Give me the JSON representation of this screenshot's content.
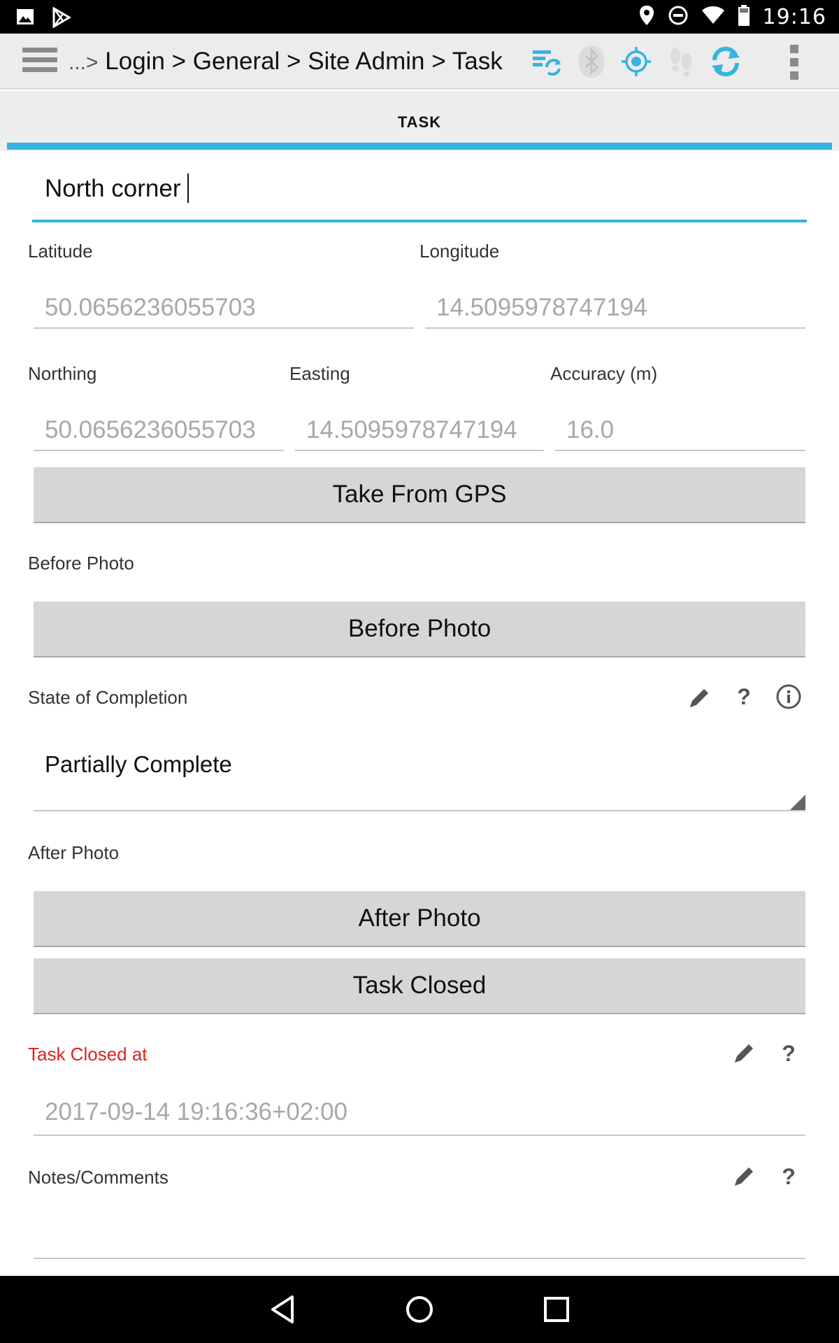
{
  "status_bar": {
    "time": "19:16"
  },
  "toolbar": {
    "breadcrumb_prefix": "...>",
    "breadcrumb": "Login > General > Site Admin > Task",
    "colors": {
      "accent": "#36b3e0"
    }
  },
  "tabs": {
    "active": "TASK"
  },
  "form": {
    "name_value": "North corner",
    "latitude": {
      "label": "Latitude",
      "value": "50.0656236055703"
    },
    "longitude": {
      "label": "Longitude",
      "value": "14.5095978747194"
    },
    "northing": {
      "label": "Northing",
      "value": "50.0656236055703"
    },
    "easting": {
      "label": "Easting",
      "value": "14.5095978747194"
    },
    "accuracy": {
      "label": "Accuracy (m)",
      "value": "16.0"
    },
    "take_gps_button": "Take From GPS",
    "before_photo": {
      "label": "Before Photo",
      "button": "Before Photo"
    },
    "state_of_completion": {
      "label": "State of Completion",
      "selected": "Partially Complete"
    },
    "after_photo": {
      "label": "After Photo",
      "button": "After Photo"
    },
    "task_closed_button": "Task Closed",
    "task_closed_at": {
      "label": "Task Closed at",
      "value": "2017-09-14 19:16:36+02:00",
      "label_color": "#e02020"
    },
    "notes": {
      "label": "Notes/Comments",
      "value": ""
    },
    "help_glyph": "?"
  }
}
